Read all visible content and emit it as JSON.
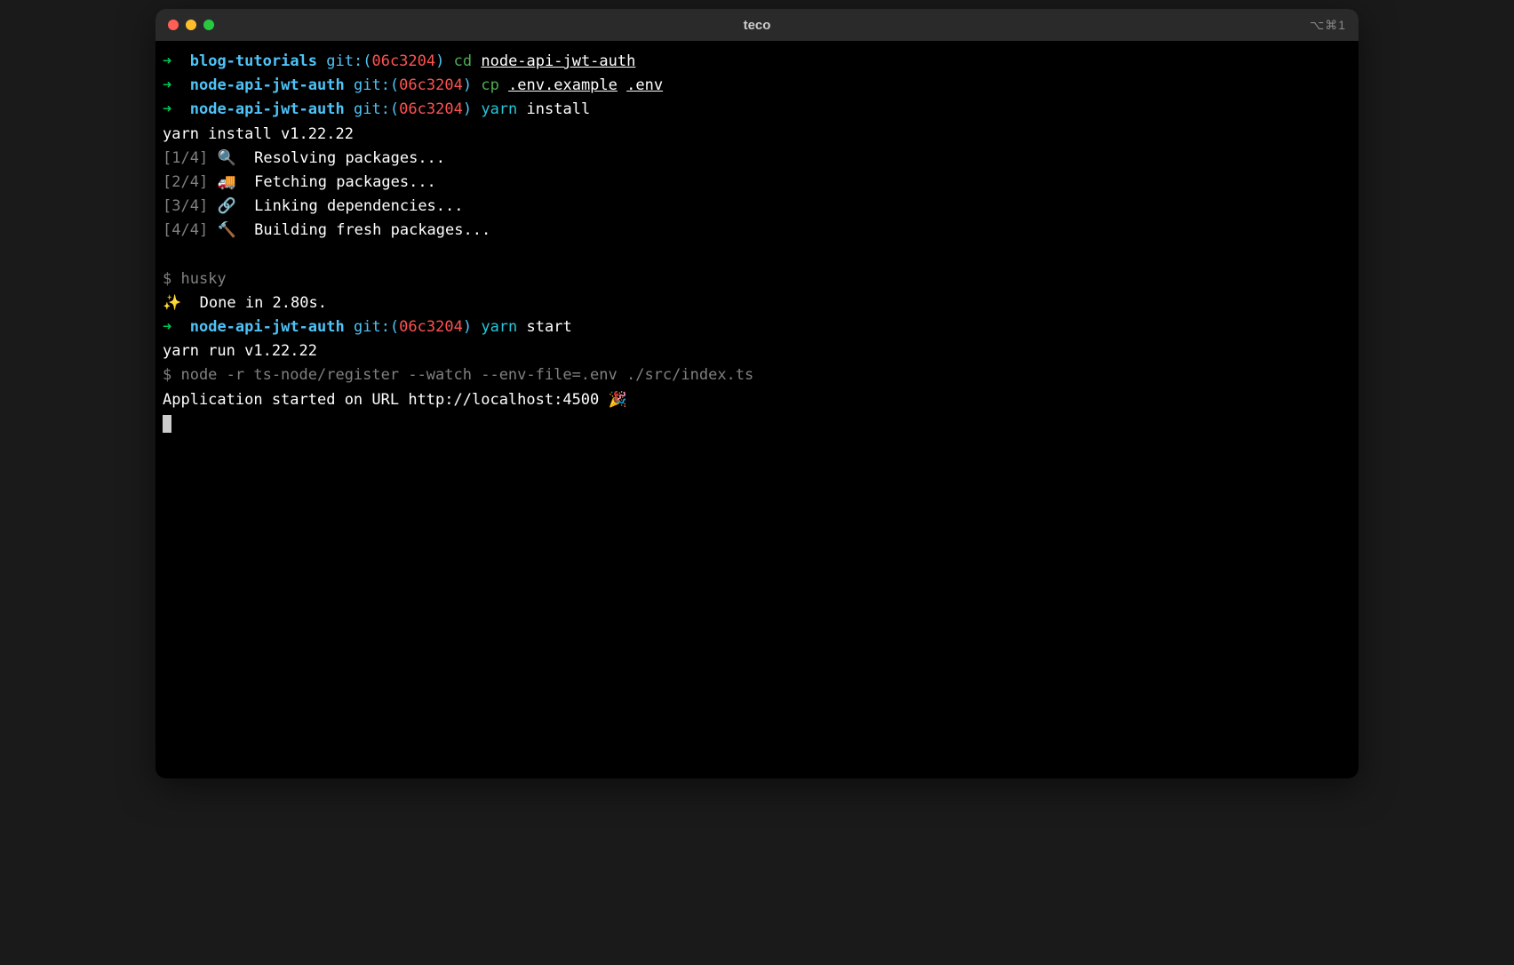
{
  "window": {
    "title": "teco",
    "shortcut": "⌥⌘1"
  },
  "prompts": [
    {
      "arrow": "➜",
      "dir": "blog-tutorials",
      "gitLabel": "git:(",
      "hash": "06c3204",
      "gitClose": ")",
      "cmd": "cd",
      "args": "node-api-jwt-auth"
    },
    {
      "arrow": "➜",
      "dir": "node-api-jwt-auth",
      "gitLabel": "git:(",
      "hash": "06c3204",
      "gitClose": ")",
      "cmd": "cp",
      "args1": ".env.example",
      "args2": ".env"
    },
    {
      "arrow": "➜",
      "dir": "node-api-jwt-auth",
      "gitLabel": "git:(",
      "hash": "06c3204",
      "gitClose": ")",
      "cmd": "yarn",
      "args": "install"
    }
  ],
  "yarnInstall": {
    "header": "yarn install v1.22.22",
    "steps": [
      {
        "num": "[1/4]",
        "icon": "🔍",
        "text": "Resolving packages..."
      },
      {
        "num": "[2/4]",
        "icon": "🚚",
        "text": "Fetching packages..."
      },
      {
        "num": "[3/4]",
        "icon": "🔗",
        "text": "Linking dependencies..."
      },
      {
        "num": "[4/4]",
        "icon": "🔨",
        "text": "Building fresh packages..."
      }
    ],
    "huskyLine": "$ husky",
    "doneIcon": "✨",
    "doneText": "Done in 2.80s."
  },
  "prompt4": {
    "arrow": "➜",
    "dir": "node-api-jwt-auth",
    "gitLabel": "git:(",
    "hash": "06c3204",
    "gitClose": ")",
    "cmd": "yarn",
    "args": "start"
  },
  "yarnRun": {
    "header": "yarn run v1.22.22",
    "nodeLine": "$ node -r ts-node/register --watch --env-file=.env ./src/index.ts",
    "appLine": "Application started on URL http://localhost:4500 🎉"
  }
}
